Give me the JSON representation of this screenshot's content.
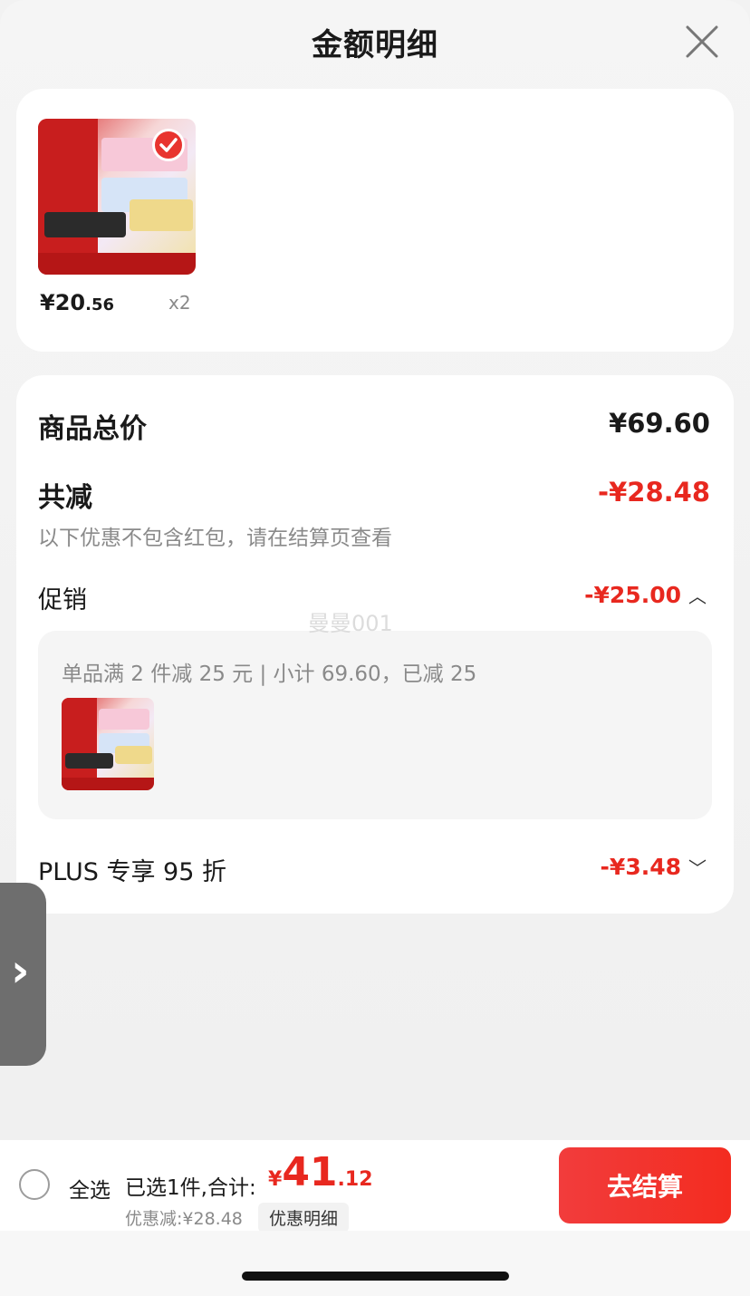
{
  "header": {
    "title": "金额明细",
    "close_icon": "close-icon"
  },
  "product": {
    "price_int": "¥20",
    "price_dec": ".56",
    "quantity": "x2",
    "image_icon": "product-image-wet-wipes"
  },
  "summary": {
    "total_label": "商品总价",
    "total_value": "¥69.60",
    "reduce_label": "共减",
    "reduce_value": "-¥28.48",
    "reduce_note": "以下优惠不包含红包，请在结算页查看",
    "promo_label": "促销",
    "promo_value": "-¥25.00",
    "promo_detail": "单品满 2 件减 25 元 | 小计 69.60，已减 25",
    "plus_label": "PLUS 专享 95 折",
    "plus_value": "-¥3.48"
  },
  "watermark": "曼曼001",
  "bottom_bar": {
    "select_all": "全选",
    "selected_count": "已选1件,合计:",
    "total_currency": "¥",
    "total_int": "41",
    "total_dec": ".12",
    "saved": "优惠减:¥28.48",
    "detail_button": "优惠明细",
    "checkout_button": "去结算"
  },
  "colors": {
    "accent_red": "#e8281f",
    "checkout_red": "#f32c20"
  }
}
